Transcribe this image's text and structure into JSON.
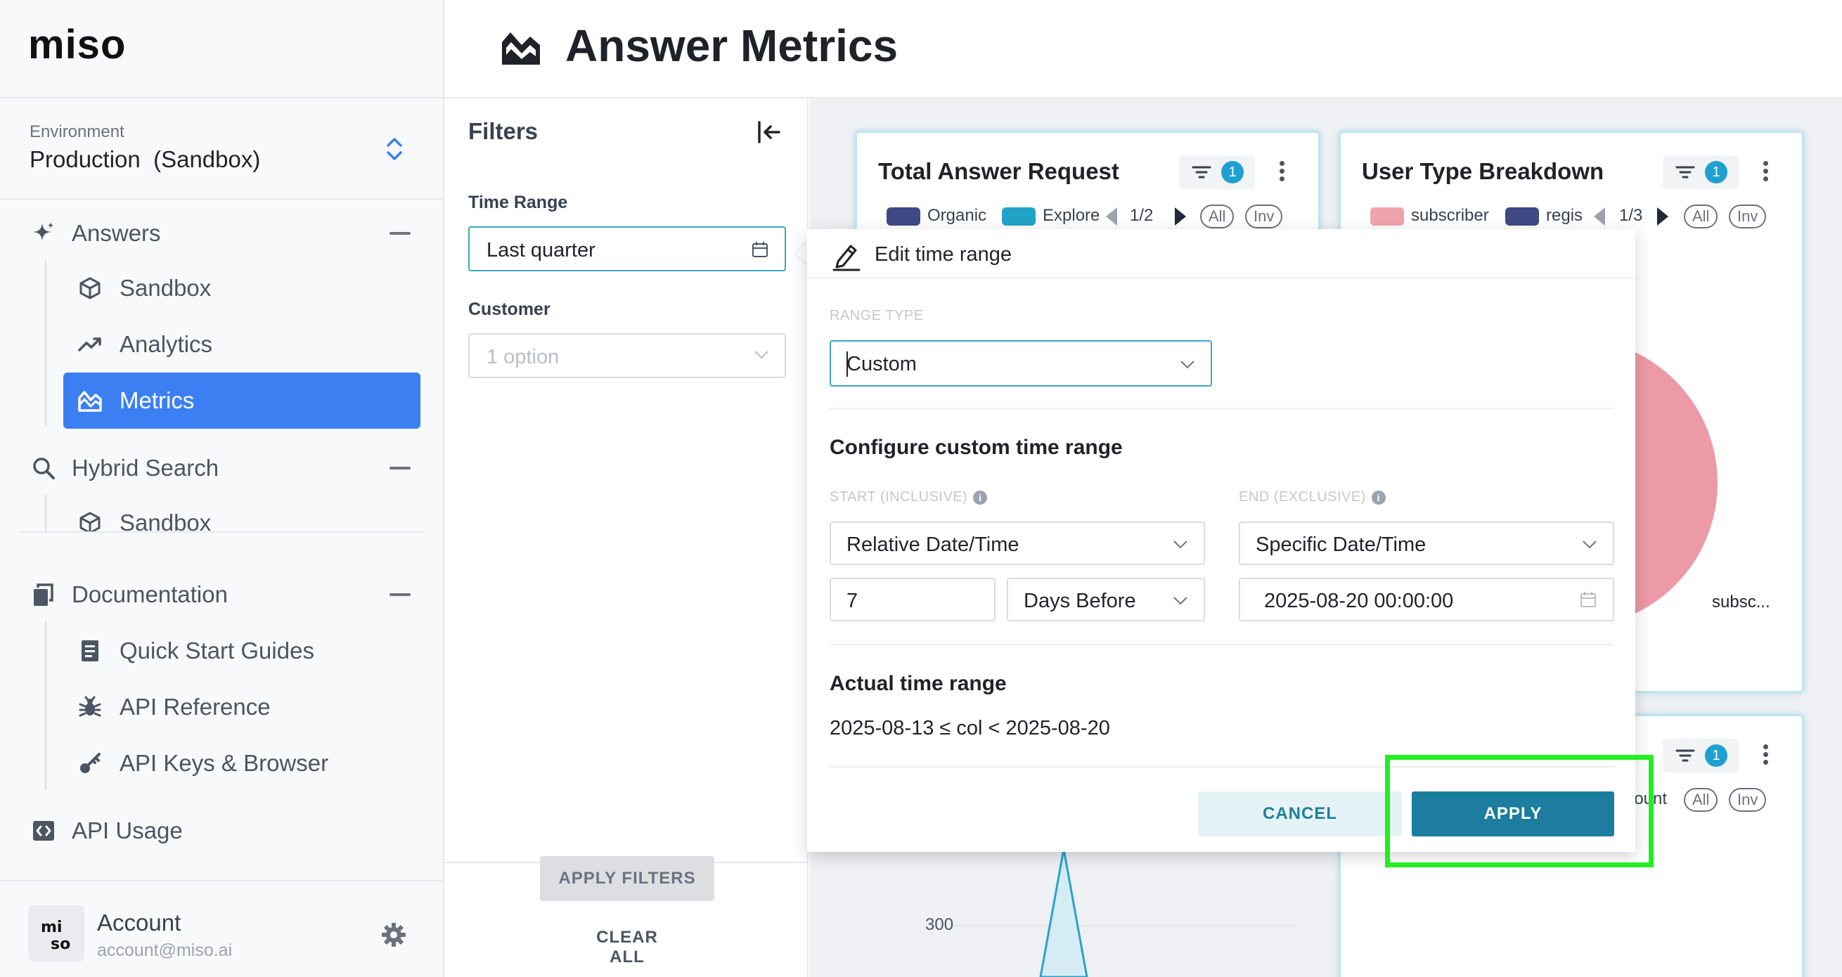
{
  "brand": {
    "logo": "miso"
  },
  "environment": {
    "label": "Environment",
    "value": "Production  (Sandbox)"
  },
  "nav": {
    "answers": {
      "label": "Answers",
      "icon": "sparkle-icon"
    },
    "answers_sandbox": {
      "label": "Sandbox",
      "icon": "cube-icon"
    },
    "answers_analytics": {
      "label": "Analytics",
      "icon": "trend-icon"
    },
    "answers_metrics": {
      "label": "Metrics",
      "icon": "chart-area-icon"
    },
    "hybrid_search": {
      "label": "Hybrid Search",
      "icon": "search-icon"
    },
    "hybrid_sandbox": {
      "label": "Sandbox",
      "icon": "cube-icon"
    },
    "documentation": {
      "label": "Documentation",
      "icon": "docs-icon"
    },
    "quick_start": {
      "label": "Quick Start Guides",
      "icon": "book-icon"
    },
    "api_reference": {
      "label": "API Reference",
      "icon": "bug-icon"
    },
    "api_keys": {
      "label": "API Keys & Browser",
      "icon": "key-icon"
    },
    "api_usage": {
      "label": "API Usage",
      "icon": "code-icon"
    }
  },
  "account": {
    "name": "Account",
    "email": "account@miso.ai",
    "avatar_text": "mi so"
  },
  "header": {
    "title": "Answer Metrics"
  },
  "filters": {
    "title": "Filters",
    "time_range_label": "Time Range",
    "time_range_value": "Last quarter",
    "customer_label": "Customer",
    "customer_placeholder": "1 option",
    "apply_label": "APPLY FILTERS",
    "clear_label": "CLEAR ALL"
  },
  "cards": {
    "total": {
      "title": "Total Answer Request",
      "filter_count": "1",
      "legend": [
        "Organic",
        "Explore"
      ],
      "legend_colors": [
        "#3f4a84",
        "#21a3c9"
      ],
      "pager": "1/2",
      "all_label": "All",
      "inv_label": "Inv",
      "y_tick": "300"
    },
    "user_type": {
      "title": "User Type Breakdown",
      "filter_count": "1",
      "legend": [
        "subscriber",
        "regis"
      ],
      "legend_colors": [
        "#f0a3ad",
        "#3f4a84"
      ],
      "pager": "1/3",
      "all_label": "All",
      "inv_label": "Inv",
      "pie_label": "subsc..."
    },
    "third": {
      "filter_count": "1",
      "legend_partial": "Count",
      "all_label": "All",
      "inv_label": "Inv"
    }
  },
  "popover": {
    "title": "Edit time range",
    "range_type_label": "RANGE TYPE",
    "range_type_value": "Custom",
    "configure_title": "Configure custom time range",
    "start_label": "START (INCLUSIVE)",
    "end_label": "END (EXCLUSIVE)",
    "start_type": "Relative Date/Time",
    "start_amount": "7",
    "start_unit": "Days Before",
    "end_type": "Specific Date/Time",
    "end_value": "2025-08-20 00:00:00",
    "actual_title": "Actual time range",
    "actual_value": "2025-08-13 ≤ col < 2025-08-20",
    "cancel_label": "CANCEL",
    "apply_label": "APPLY"
  },
  "colors": {
    "accent": "#3b7ff3",
    "teal": "#1c7d9e",
    "highlight": "#22ee22"
  }
}
